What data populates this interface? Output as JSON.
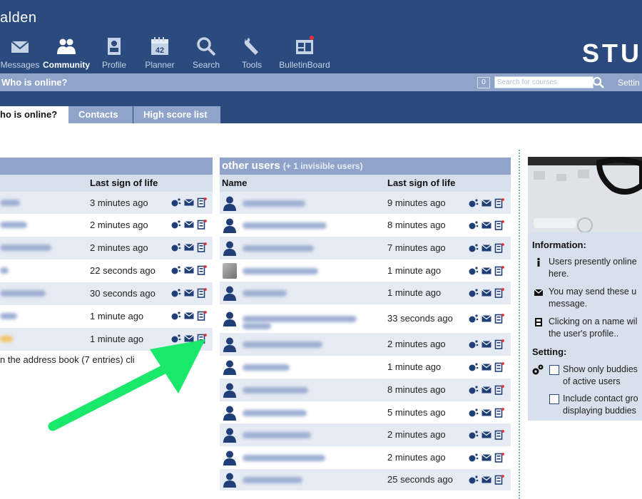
{
  "header": {
    "brand": "alden",
    "logo": "STU",
    "nav": [
      {
        "label": "Messages",
        "icon": "envelope-icon"
      },
      {
        "label": "Community",
        "icon": "people-icon",
        "active": true
      },
      {
        "label": "Profile",
        "icon": "profile-icon"
      },
      {
        "label": "Planner",
        "icon": "calendar-icon",
        "badge": "42"
      },
      {
        "label": "Search",
        "icon": "magnifier-icon"
      },
      {
        "label": "Tools",
        "icon": "wrench-icon"
      },
      {
        "label": "BulletinBoard",
        "icon": "bulletin-board-icon"
      }
    ]
  },
  "subbar": {
    "title": "Who is online?",
    "count": "0",
    "search_placeholder": "Search for courses",
    "settings": "Settin"
  },
  "tabs": [
    {
      "label": "ho is online?",
      "active": true
    },
    {
      "label": "Contacts"
    },
    {
      "label": "High score list"
    }
  ],
  "left_table": {
    "header": "",
    "last_sign_header": "Last sign of life",
    "rows": [
      "3 minutes ago",
      "2 minutes ago",
      "2 minutes ago",
      "22 seconds ago",
      "30 seconds ago",
      "1 minute ago",
      "1 minute ago"
    ],
    "note": "n the address book (7 entries) cli"
  },
  "right_table": {
    "title": "other users",
    "subtitle": "(+ 1 invisible users)",
    "name_header": "Name",
    "last_sign_header": "Last sign of life",
    "rows": [
      "9 minutes ago",
      "8 minutes ago",
      "7 minutes ago",
      "1 minute ago",
      "1 minute ago",
      "33 seconds ago",
      "2 minutes ago",
      "1 minute ago",
      "8 minutes ago",
      "5 minutes ago",
      "2 minutes ago",
      "2 minutes ago",
      "25 seconds ago"
    ]
  },
  "sidebar": {
    "info_title": "Information:",
    "info1": [
      "Users presently online",
      "here."
    ],
    "info2": [
      "You may send these u",
      "message."
    ],
    "info3": [
      "Clicking on a name wil",
      "the user's profile.."
    ],
    "setting_title": "Setting:",
    "opt1": [
      "Show only buddies",
      "of active users"
    ],
    "opt2": [
      "Include contact gro",
      "displaying buddies"
    ]
  },
  "colors": {
    "header_bg": "#2b4a7e",
    "bar_bg": "#8fa4c8",
    "row_alt": "#e6ebf3",
    "arrow": "#19e86a"
  }
}
